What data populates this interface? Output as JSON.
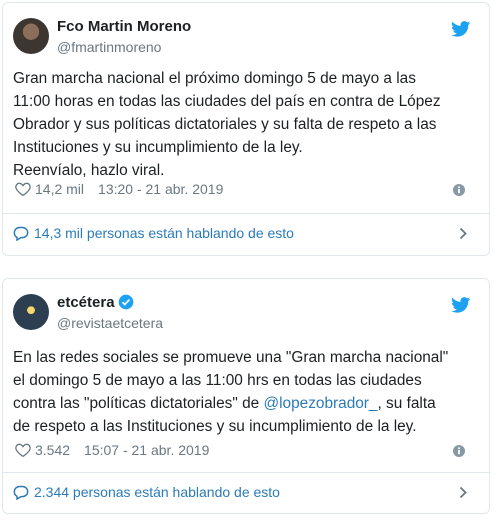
{
  "tweets": [
    {
      "name": "Fco Martin Moreno",
      "handle": "@fmartinmoreno",
      "verified": false,
      "lines": [
        "Gran marcha nacional el próximo domingo 5 de mayo a las",
        "11:00 horas en todas las ciudades del país en contra de López",
        "Obrador y sus políticas dictatoriales y su falta de respeto a las",
        "Instituciones y su incumplimiento de la ley.",
        "Reenvíalo, hazlo viral."
      ],
      "likes": "14,2 mil",
      "timestamp": "13:20 - 21 abr. 2019",
      "conversation": "14,3 mil personas están hablando de esto"
    },
    {
      "name": "etcétera",
      "handle": "@revistaetcetera",
      "verified": true,
      "lines": [
        "En las redes sociales se promueve una \"Gran marcha nacional\"",
        "el domingo 5 de mayo a las 11:00 hrs en todas las ciudades",
        "contra las \"políticas dictatoriales\" de ",
        "de respeto a las Instituciones y su incumplimiento de la ley."
      ],
      "line3_mention": "@lopezobrador_",
      "line3_tail": ", su falta",
      "likes": "3.542",
      "timestamp": "15:07 - 21 abr. 2019",
      "conversation": "2.344 personas están hablando de esto"
    }
  ],
  "colors": {
    "twitter_blue": "#1da1f2",
    "link_blue": "#2b7bb9",
    "muted_gray": "#697882",
    "border": "#e1e8ed"
  },
  "icons": [
    "twitter-bird-icon",
    "verified-badge-icon",
    "heart-icon",
    "info-icon",
    "speech-bubble-icon",
    "chevron-right-icon"
  ]
}
